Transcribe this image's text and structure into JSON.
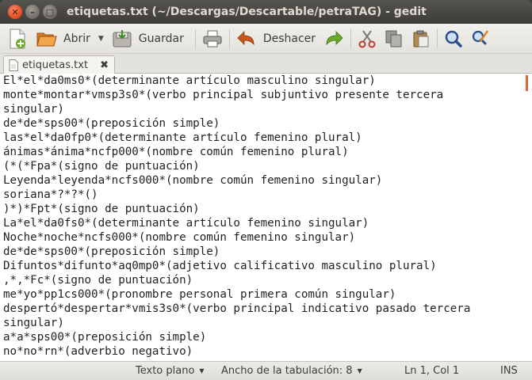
{
  "window": {
    "title": "etiquetas.txt (~/Descargas/Descartable/petraTAG) - gedit",
    "controls": {
      "close": "✕",
      "minimize": "–",
      "maximize": "□"
    }
  },
  "toolbar": {
    "open_label": "Abrir",
    "save_label": "Guardar",
    "undo_label": "Deshacer"
  },
  "tab": {
    "label": "etiquetas.txt",
    "close": "✖"
  },
  "editor": {
    "lines": [
      "El*el*da0ms0*(determinante artículo masculino singular)",
      "monte*montar*vmsp3s0*(verbo principal subjuntivo presente tercera",
      "singular)",
      "de*de*sps00*(preposición simple)",
      "las*el*da0fp0*(determinante artículo femenino plural)",
      "ánimas*ánima*ncfp000*(nombre común femenino plural)",
      "(*(*Fpa*(signo de puntuación)",
      "Leyenda*leyenda*ncfs000*(nombre común femenino singular)",
      "soriana*?*?*()",
      ")*)*Fpt*(signo de puntuación)",
      "La*el*da0fs0*(determinante artículo femenino singular)",
      "Noche*noche*ncfs000*(nombre común femenino singular)",
      "de*de*sps00*(preposición simple)",
      "Difuntos*difunto*aq0mp0*(adjetivo calificativo masculino plural)",
      ",*,*Fc*(signo de puntuación)",
      "me*yo*pp1cs000*(pronombre personal primera común singular)",
      "despertó*despertar*vmis3s0*(verbo principal indicativo pasado tercera",
      "singular)",
      "a*a*sps00*(preposición simple)",
      "no*no*rn*(adverbio negativo)"
    ]
  },
  "statusbar": {
    "language": "Texto plano",
    "tab_width": "Ancho de la tabulación:  8",
    "position": "Ln 1, Col 1",
    "mode": "INS"
  },
  "colors": {
    "titlebar": "#3c3b37",
    "close_button": "#e3491a",
    "toolbar_bg": "#ebe9e4",
    "editor_bg": "#ffffff"
  }
}
